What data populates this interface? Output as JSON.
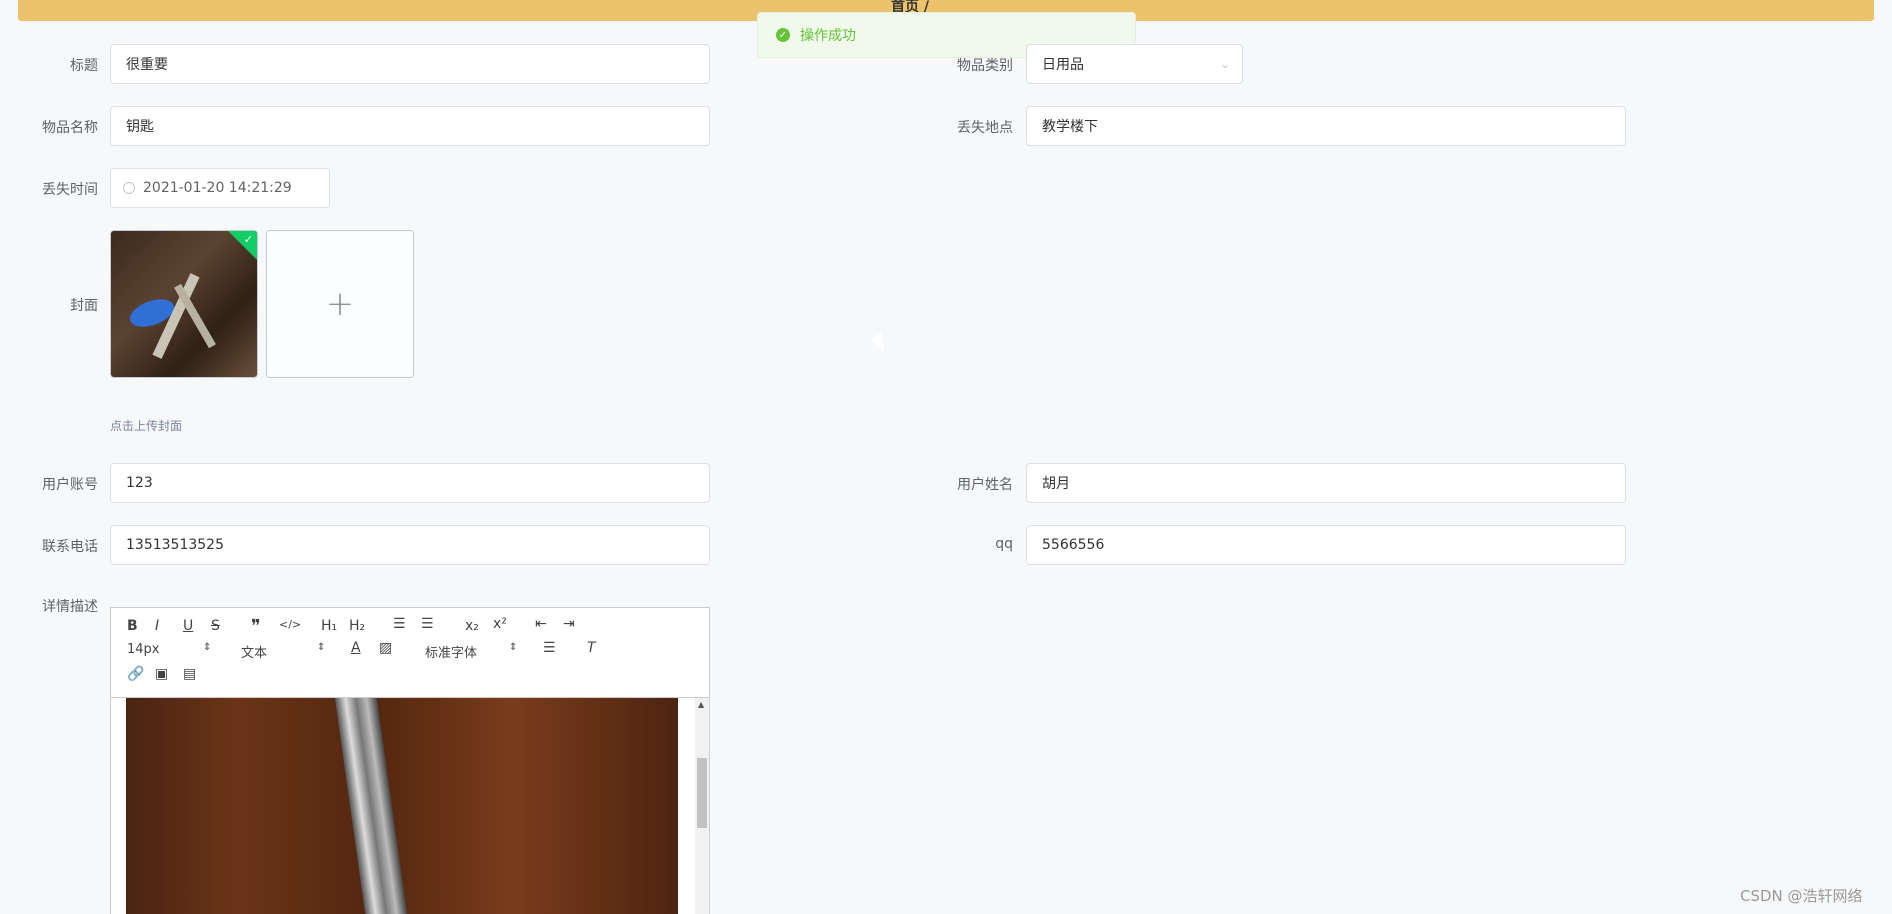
{
  "topbar": {
    "crumb_main": "首页 /",
    "crumb_sub": ""
  },
  "toast": {
    "message": "操作成功"
  },
  "form": {
    "title": {
      "label": "标题",
      "value": "很重要"
    },
    "category": {
      "label": "物品类别",
      "value": "日用品"
    },
    "item_name": {
      "label": "物品名称",
      "value": "钥匙"
    },
    "lost_place": {
      "label": "丢失地点",
      "value": "教学楼下"
    },
    "lost_time": {
      "label": "丢失时间",
      "value": "2021-01-20 14:21:29"
    },
    "cover": {
      "label": "封面",
      "hint": "点击上传封面",
      "add_icon": "+"
    },
    "user_account": {
      "label": "用户账号",
      "value": "123"
    },
    "user_name": {
      "label": "用户姓名",
      "value": "胡月"
    },
    "phone": {
      "label": "联系电话",
      "value": "13513513525"
    },
    "qq": {
      "label": "qq",
      "value": "5566556"
    },
    "description": {
      "label": "详情描述"
    }
  },
  "editor": {
    "font_size": "14px",
    "paragraph": "文本",
    "font_family": "标准字体"
  },
  "watermark": "CSDN @浩轩网络"
}
